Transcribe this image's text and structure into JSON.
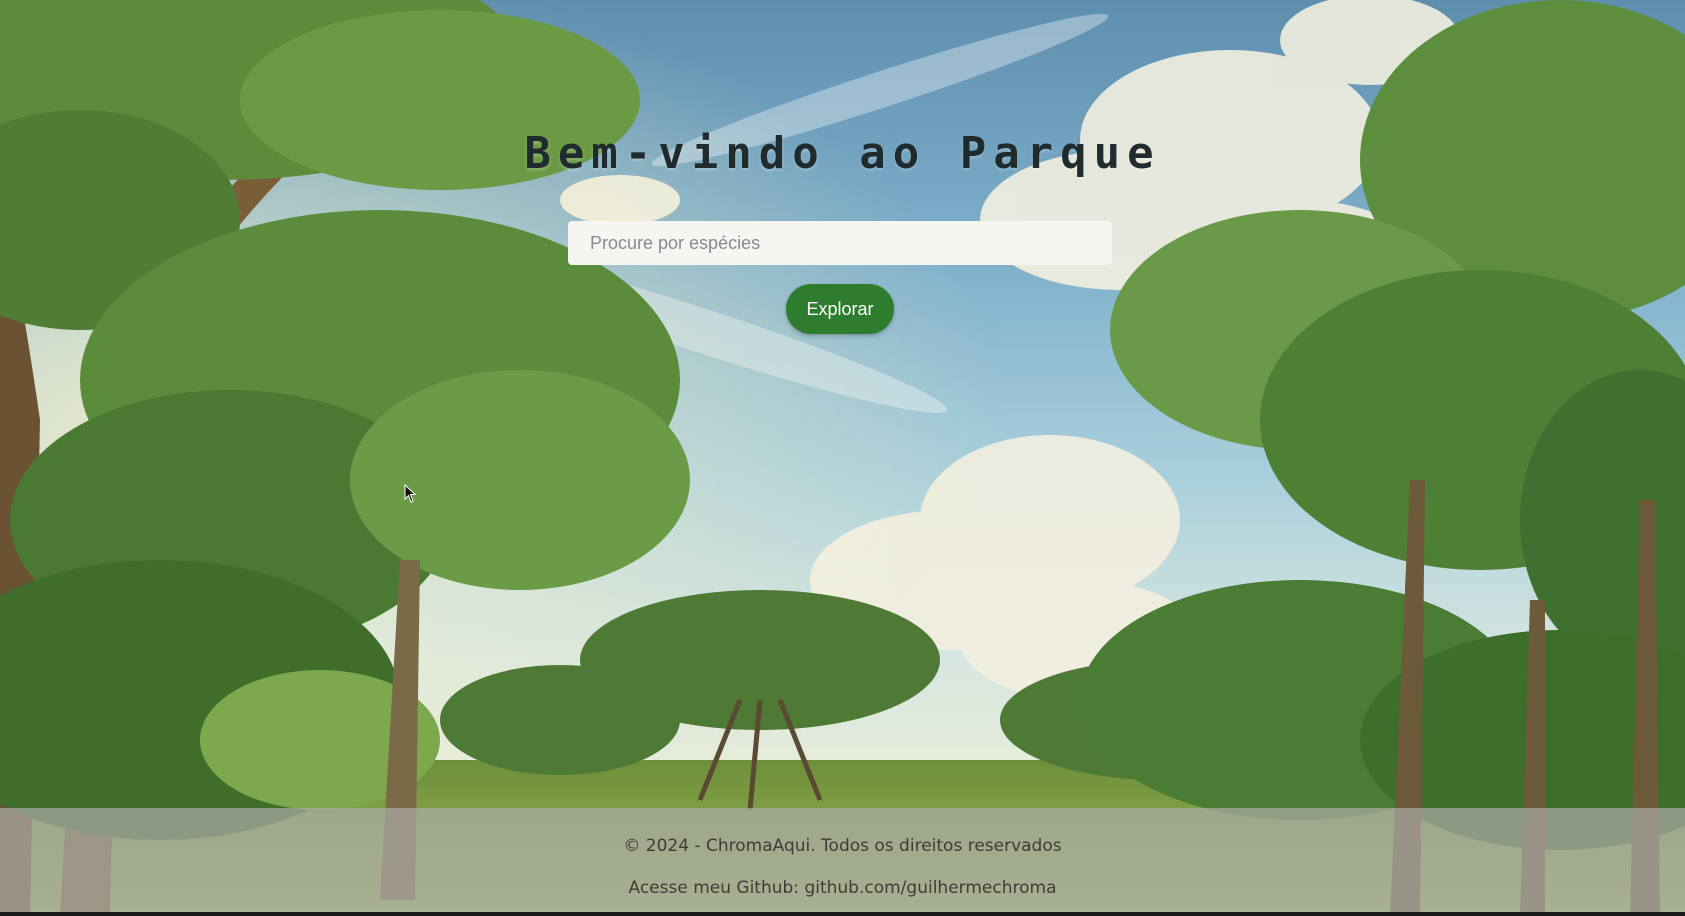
{
  "hero": {
    "title": "Bem-vindo ao Parque",
    "search": {
      "placeholder": "Procure por espécies",
      "value": ""
    },
    "explore_label": "Explorar"
  },
  "footer": {
    "copyright": "© 2024 - ChromaAqui. Todos os direitos reservados",
    "github_prefix": "Acesse meu Github: ",
    "github_link": "github.com/guilhermechroma"
  },
  "colors": {
    "button_bg": "#2e7d2e",
    "title_text": "#1f2b2d",
    "footer_bg": "#aaaaa5"
  },
  "icons": {
    "cursor": "mouse-pointer-icon"
  }
}
